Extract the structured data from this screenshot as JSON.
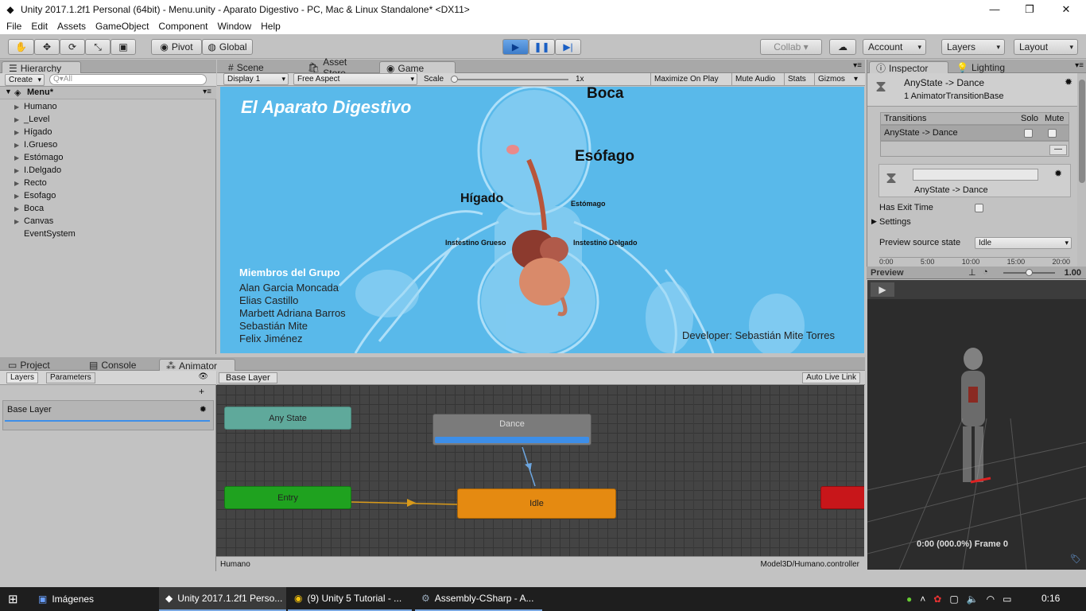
{
  "window": {
    "title": "Unity 2017.1.2f1 Personal (64bit) - Menu.unity - Aparato Digestivo - PC, Mac & Linux Standalone* <DX11>",
    "minimize": "—",
    "maximize": "❐",
    "close": "✕"
  },
  "menu": [
    "File",
    "Edit",
    "Assets",
    "GameObject",
    "Component",
    "Window",
    "Help"
  ],
  "toolbar": {
    "pivot": "Pivot",
    "global": "Global",
    "collab": "Collab ▾",
    "account": "Account",
    "layers": "Layers",
    "layout": "Layout"
  },
  "hierarchy": {
    "tab": "Hierarchy",
    "create": "Create",
    "search_placeholder": "Q▾All",
    "scene": "Menu*",
    "items": [
      {
        "label": "Humano",
        "arrow": true
      },
      {
        "label": "_Level",
        "arrow": true
      },
      {
        "label": "Hígado",
        "arrow": true
      },
      {
        "label": "I.Grueso",
        "arrow": true
      },
      {
        "label": "Estómago",
        "arrow": true
      },
      {
        "label": "I.Delgado",
        "arrow": true
      },
      {
        "label": "Recto",
        "arrow": true
      },
      {
        "label": "Esofago",
        "arrow": true
      },
      {
        "label": "Boca",
        "arrow": true
      },
      {
        "label": "Canvas",
        "arrow": true
      },
      {
        "label": "EventSystem",
        "arrow": false
      }
    ]
  },
  "center_tabs": {
    "scene": "Scene",
    "asset_store": "Asset Store",
    "game": "Game"
  },
  "game_bar": {
    "display": "Display 1",
    "aspect": "Free Aspect",
    "scale_label": "Scale",
    "scale_value": "1x",
    "maximize": "Maximize On Play",
    "mute": "Mute Audio",
    "stats": "Stats",
    "gizmos": "Gizmos"
  },
  "game": {
    "title": "El Aparato Digestivo",
    "boca": "Boca",
    "esofago": "Esófago",
    "higado": "Hígado",
    "estomago": "Estómago",
    "igrueso": "Instestino Grueso",
    "idelgado": "Instestino Delgado",
    "members_title": "Miembros del Grupo",
    "members": [
      "Alan Garcia Moncada",
      "Elias Castillo",
      "Marbett Adriana Barros",
      "Sebastián Mite",
      "Felix Jiménez"
    ],
    "developer": "Developer: Sebastián Mite Torres"
  },
  "bottom_tabs": {
    "project": "Project",
    "console": "Console",
    "animator": "Animator"
  },
  "animator": {
    "layers_tab": "Layers",
    "params_tab": "Parameters",
    "base_layer": "Base Layer",
    "breadcrumb": "Base Layer",
    "auto_live": "Auto Live Link",
    "states": {
      "any": "Any State",
      "dance": "Dance",
      "entry": "Entry",
      "idle": "Idle"
    },
    "footer_left": "Humano",
    "footer_right": "Model3D/Humano.controller"
  },
  "inspector": {
    "tab": "Inspector",
    "lighting_tab": "Lighting",
    "header": "AnyState -> Dance",
    "sub": "1 AnimatorTransitionBase",
    "transitions": "Transitions",
    "solo": "Solo",
    "mute": "Mute",
    "transition_row": "AnyState -> Dance",
    "transition_name": "AnyState -> Dance",
    "has_exit": "Has Exit Time",
    "settings": "Settings",
    "preview_source": "Preview source state",
    "preview_value": "Idle",
    "timeline": [
      "0:00",
      "5:00",
      "10:00",
      "15:00",
      "20:00"
    ]
  },
  "preview": {
    "label": "Preview",
    "value": "1.00",
    "frame": "0:00 (000.0%) Frame 0"
  },
  "taskbar": {
    "items": [
      "Imágenes",
      "Unity 2017.1.2f1 Perso...",
      "(9) Unity 5 Tutorial - ...",
      "Assembly-CSharp - A..."
    ],
    "clock": "0:16"
  },
  "colors": {
    "accent": "#3d8ee8",
    "game_bg": "#59b9ea",
    "entry": "#1fa21f",
    "idle": "#e58a11",
    "anystate": "#5fa99b",
    "exit": "#c8161a"
  }
}
